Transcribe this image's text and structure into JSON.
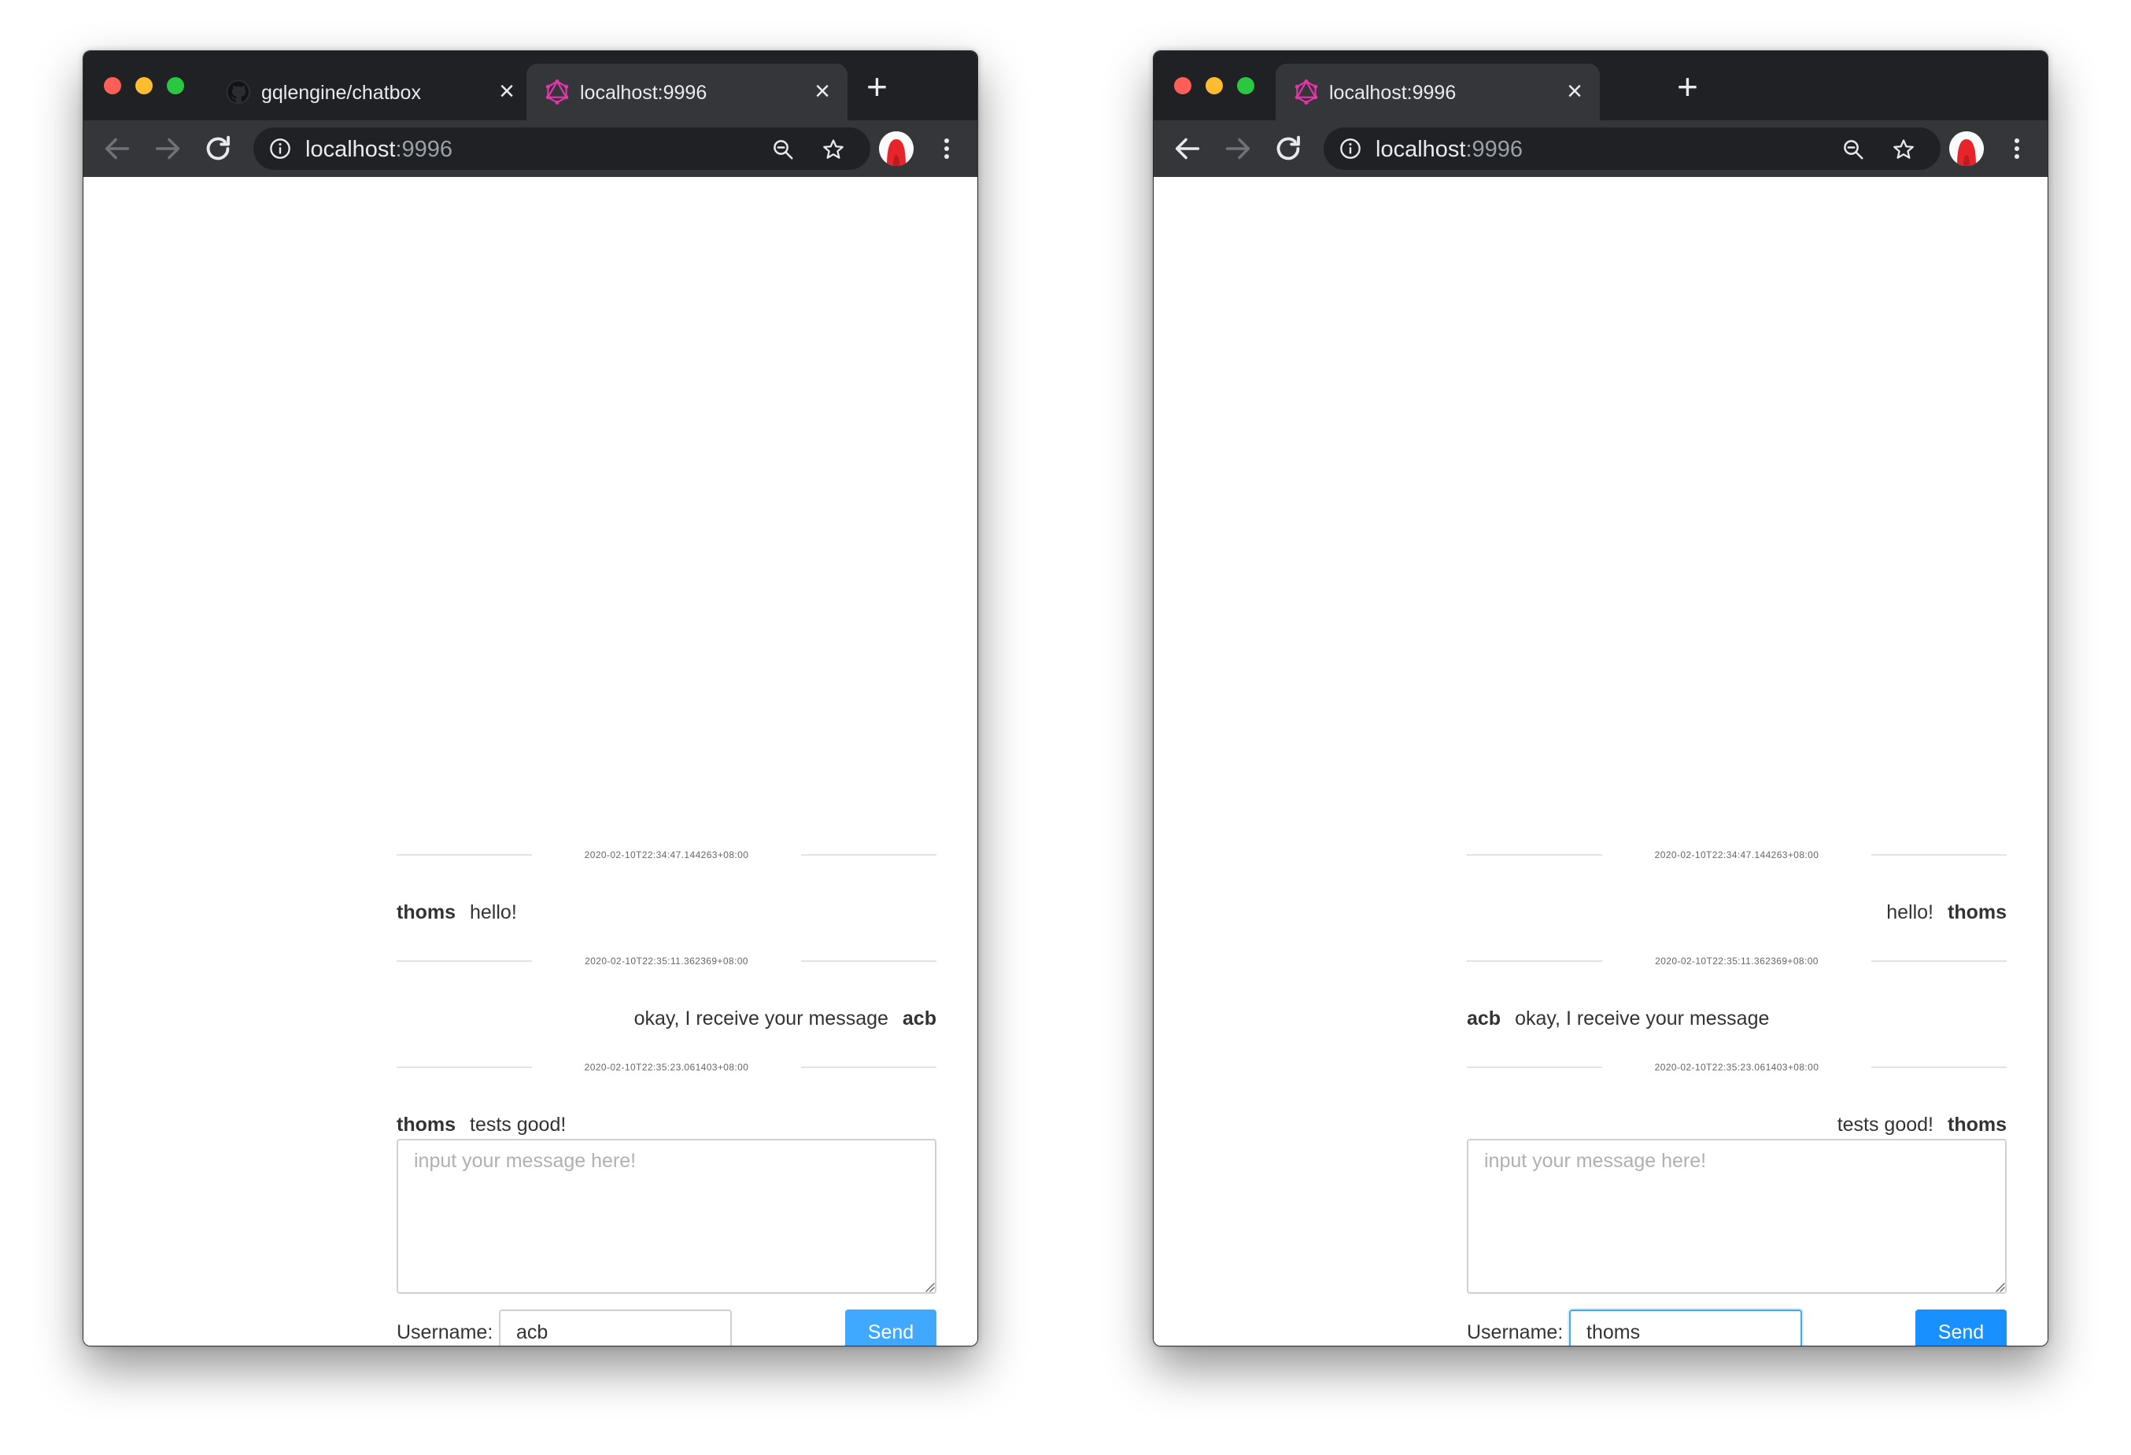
{
  "windows": {
    "left": {
      "tabs": [
        {
          "title": "gqlengine/chatbox",
          "icon": "github-icon",
          "close": "×"
        },
        {
          "title": "localhost:9996",
          "icon": "graphql-icon",
          "close": "×"
        }
      ],
      "new_tab": "+",
      "url": {
        "host": "localhost",
        "port": ":9996"
      },
      "chat": {
        "rows": [
          {
            "timestamp": "2020-02-10T22:34:47.144263+08:00",
            "user": "thoms",
            "text": "hello!",
            "align": "left"
          },
          {
            "timestamp": "2020-02-10T22:35:11.362369+08:00",
            "user": "acb",
            "text": "okay, I receive your message",
            "align": "right"
          },
          {
            "timestamp": "2020-02-10T22:35:23.061403+08:00",
            "user": "thoms",
            "text": "tests good!",
            "align": "left"
          }
        ]
      },
      "composer": {
        "placeholder": "input your message here!"
      },
      "username_label": "Username:",
      "username_value": "acb",
      "send_label": "Send"
    },
    "right": {
      "tabs": [
        {
          "title": "localhost:9996",
          "icon": "graphql-icon",
          "close": "×"
        }
      ],
      "new_tab": "+",
      "url": {
        "host": "localhost",
        "port": ":9996"
      },
      "chat": {
        "rows": [
          {
            "timestamp": "2020-02-10T22:34:47.144263+08:00",
            "user": "thoms",
            "text": "hello!",
            "align": "right"
          },
          {
            "timestamp": "2020-02-10T22:35:11.362369+08:00",
            "user": "acb",
            "text": "okay, I receive your message",
            "align": "left"
          },
          {
            "timestamp": "2020-02-10T22:35:23.061403+08:00",
            "user": "thoms",
            "text": "tests good!",
            "align": "right"
          }
        ]
      },
      "composer": {
        "placeholder": "input your message here!"
      },
      "username_label": "Username:",
      "username_value": "thoms",
      "send_label": "Send"
    }
  },
  "colors": {
    "chrome_frame": "#202124",
    "chrome_toolbar": "#35363a",
    "graphql_pink": "#e535ab",
    "send_button_light": "#40a9ff",
    "send_button_solid": "#1890ff",
    "focus_border": "#40a9ff",
    "traffic_red": "#ff5f57",
    "traffic_yellow": "#febc2e",
    "traffic_green": "#28c840"
  }
}
